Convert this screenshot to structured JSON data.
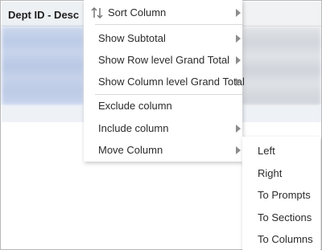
{
  "table": {
    "column_header": "Dept ID - Desc"
  },
  "context_menu": {
    "items": [
      {
        "label": "Sort Column",
        "has_submenu": true
      },
      {
        "label": "Show Subtotal",
        "has_submenu": true
      },
      {
        "label": "Show Row level Grand Total",
        "has_submenu": true
      },
      {
        "label": "Show Column level Grand Total",
        "has_submenu": true
      },
      {
        "label": "Exclude column",
        "has_submenu": false
      },
      {
        "label": "Include column",
        "has_submenu": true
      },
      {
        "label": "Move Column",
        "has_submenu": true
      }
    ]
  },
  "move_submenu": {
    "items": [
      {
        "label": "Left"
      },
      {
        "label": "Right"
      },
      {
        "label": "To Prompts"
      },
      {
        "label": "To Sections"
      },
      {
        "label": "To Columns"
      }
    ]
  }
}
